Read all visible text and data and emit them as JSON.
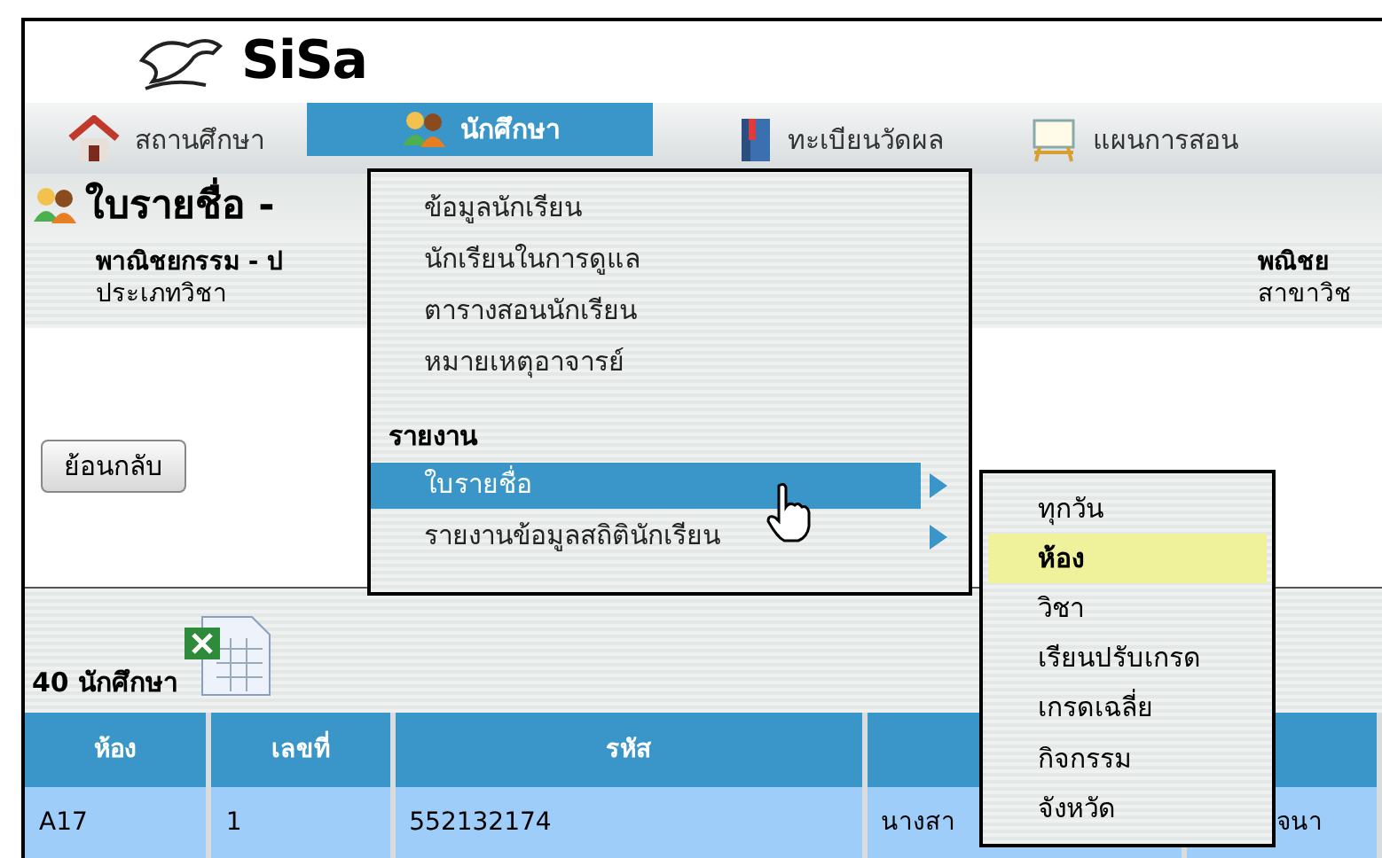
{
  "logo": {
    "text": "SiSa"
  },
  "nav": [
    {
      "label": "สถานศึกษา",
      "kind": "house",
      "selected": false
    },
    {
      "label": "นักศึกษา",
      "kind": "people",
      "selected": true
    },
    {
      "label": "ทะเบียนวัดผล",
      "kind": "book",
      "selected": false
    },
    {
      "label": "แผนการสอน",
      "kind": "board",
      "selected": false
    }
  ],
  "page_title": "ใบรายชื่อ -",
  "info": {
    "left_title": "พาณิชยกรรม - ป",
    "left_sub": "ประเภทวิชา",
    "right_title": "พณิชย",
    "right_sub": "สาขาวิช"
  },
  "back_button": "ย้อนกลับ",
  "count_label": "40 นักศึกษา",
  "table": {
    "columns": [
      "ห้อง",
      "เลขที่",
      "รหัส",
      "",
      ""
    ],
    "rows": [
      [
        "A17",
        "1",
        "552132174",
        "นางสา",
        "จนา"
      ]
    ]
  },
  "menu": {
    "items": [
      {
        "kind": "item",
        "label": "ข้อมูลนักเรียน",
        "selected": false,
        "submenu": false
      },
      {
        "kind": "item",
        "label": "นักเรียนในการดูแล",
        "selected": false,
        "submenu": false
      },
      {
        "kind": "item",
        "label": "ตารางสอนนักเรียน",
        "selected": false,
        "submenu": false
      },
      {
        "kind": "item",
        "label": "หมายเหตุอาจารย์",
        "selected": false,
        "submenu": false
      },
      {
        "kind": "heading",
        "label": "รายงาน"
      },
      {
        "kind": "item",
        "label": "ใบรายชื่อ",
        "selected": true,
        "submenu": true
      },
      {
        "kind": "item",
        "label": "รายงานข้อมูลสถิตินักเรียน",
        "selected": false,
        "submenu": true
      }
    ]
  },
  "submenu": {
    "items": [
      {
        "label": "ทุกวัน",
        "selected": false
      },
      {
        "label": "ห้อง",
        "selected": true
      },
      {
        "label": "วิชา",
        "selected": false
      },
      {
        "label": "เรียนปรับเกรด",
        "selected": false
      },
      {
        "label": "เกรดเฉลี่ย",
        "selected": false
      },
      {
        "label": "กิจกรรม",
        "selected": false
      },
      {
        "label": "จังหวัด",
        "selected": false
      }
    ]
  }
}
